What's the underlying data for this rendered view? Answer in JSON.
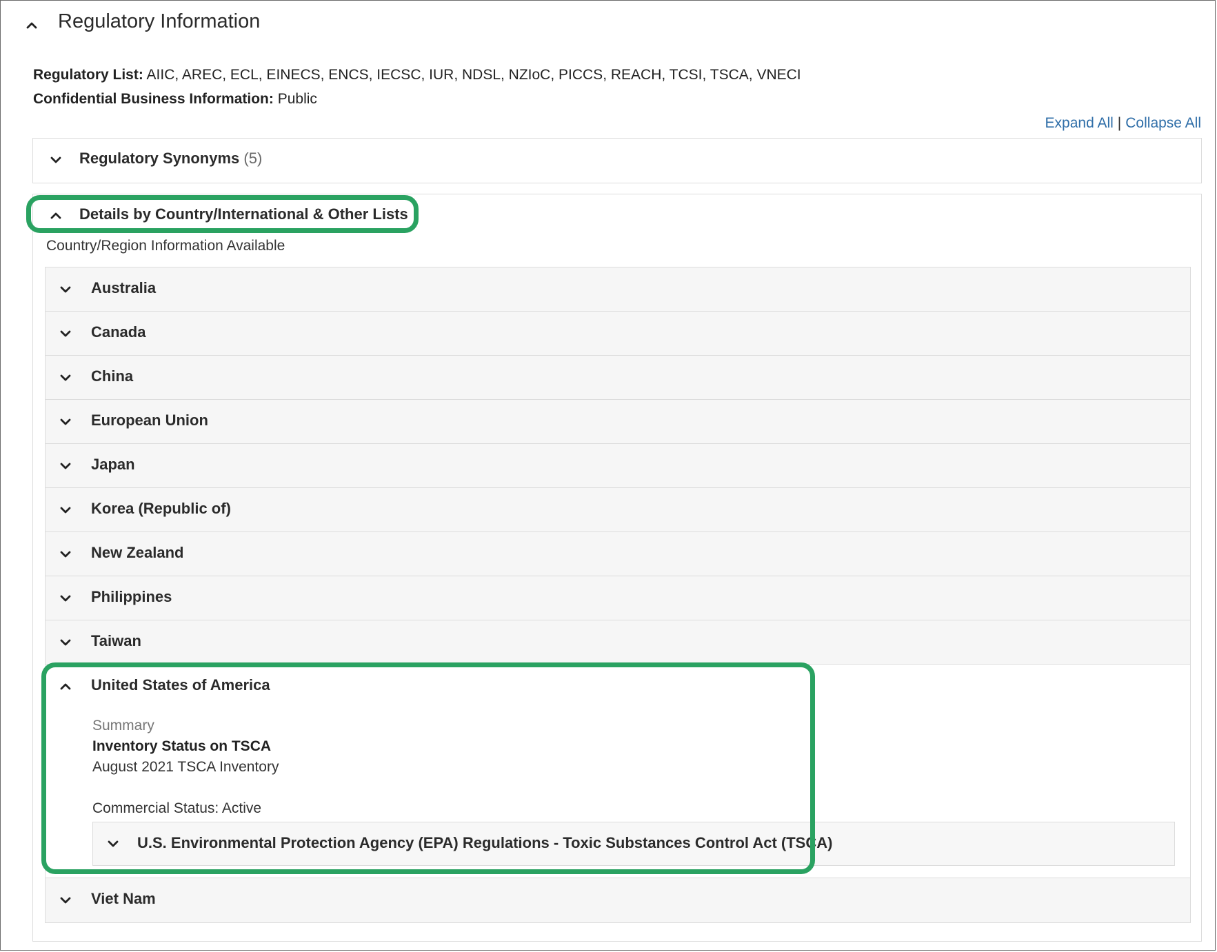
{
  "section": {
    "title": "Regulatory Information"
  },
  "meta": {
    "regulatory_list_label": "Regulatory List:",
    "regulatory_list_value": "AIIC, AREC, ECL, EINECS, ENCS, IECSC, IUR, NDSL, NZIoC, PICCS, REACH, TCSI, TSCA, VNECI",
    "cbi_label": "Confidential Business Information:",
    "cbi_value": "Public"
  },
  "toolbar": {
    "expand_all": "Expand All",
    "separator": "|",
    "collapse_all": "Collapse All"
  },
  "synonyms": {
    "label": "Regulatory Synonyms",
    "count": "(5)"
  },
  "details": {
    "label": "Details by Country/International & Other Lists",
    "note": "Country/Region Information Available"
  },
  "countries": [
    {
      "label": "Australia"
    },
    {
      "label": "Canada"
    },
    {
      "label": "China"
    },
    {
      "label": "European Union"
    },
    {
      "label": "Japan"
    },
    {
      "label": "Korea (Republic of)"
    },
    {
      "label": "New Zealand"
    },
    {
      "label": "Philippines"
    },
    {
      "label": "Taiwan"
    },
    {
      "label": "United States of America",
      "summary_label": "Summary",
      "inventory_title": "Inventory Status on TSCA",
      "inventory_sub": "August 2021 TSCA Inventory",
      "commercial_status": "Commercial Status: Active",
      "regulation": "U.S. Environmental Protection Agency (EPA) Regulations - Toxic Substances Control Act (TSCA)"
    },
    {
      "label": "Viet Nam"
    }
  ],
  "colors": {
    "highlight": "#2aa261",
    "link": "#2f6ea8",
    "row_bg": "#f6f6f6"
  },
  "icons": {
    "collapsed": "chevron-down-icon",
    "expanded": "chevron-up-icon"
  }
}
